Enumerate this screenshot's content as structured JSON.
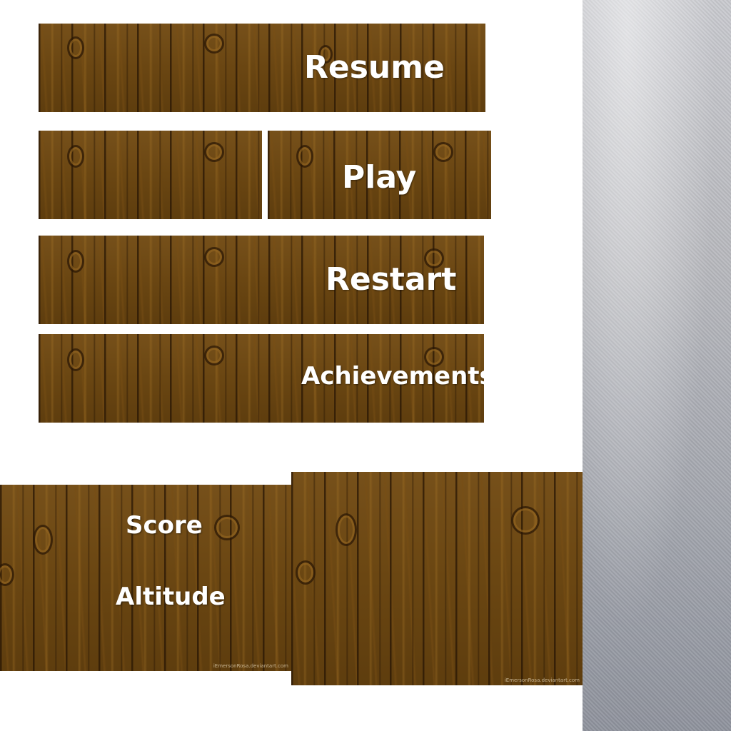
{
  "menu": {
    "resume_label": "Resume",
    "play_label": "Play",
    "restart_label": "Restart",
    "achievements_label": "Achievements"
  },
  "hud": {
    "score_label": "Score",
    "altitude_label": "Altitude"
  },
  "credits": {
    "watermark": "iEmersonRosa.deviantart.com"
  },
  "colors": {
    "wood": "#6e4a14",
    "text": "#ffffff",
    "metal": "#b8b9be"
  }
}
